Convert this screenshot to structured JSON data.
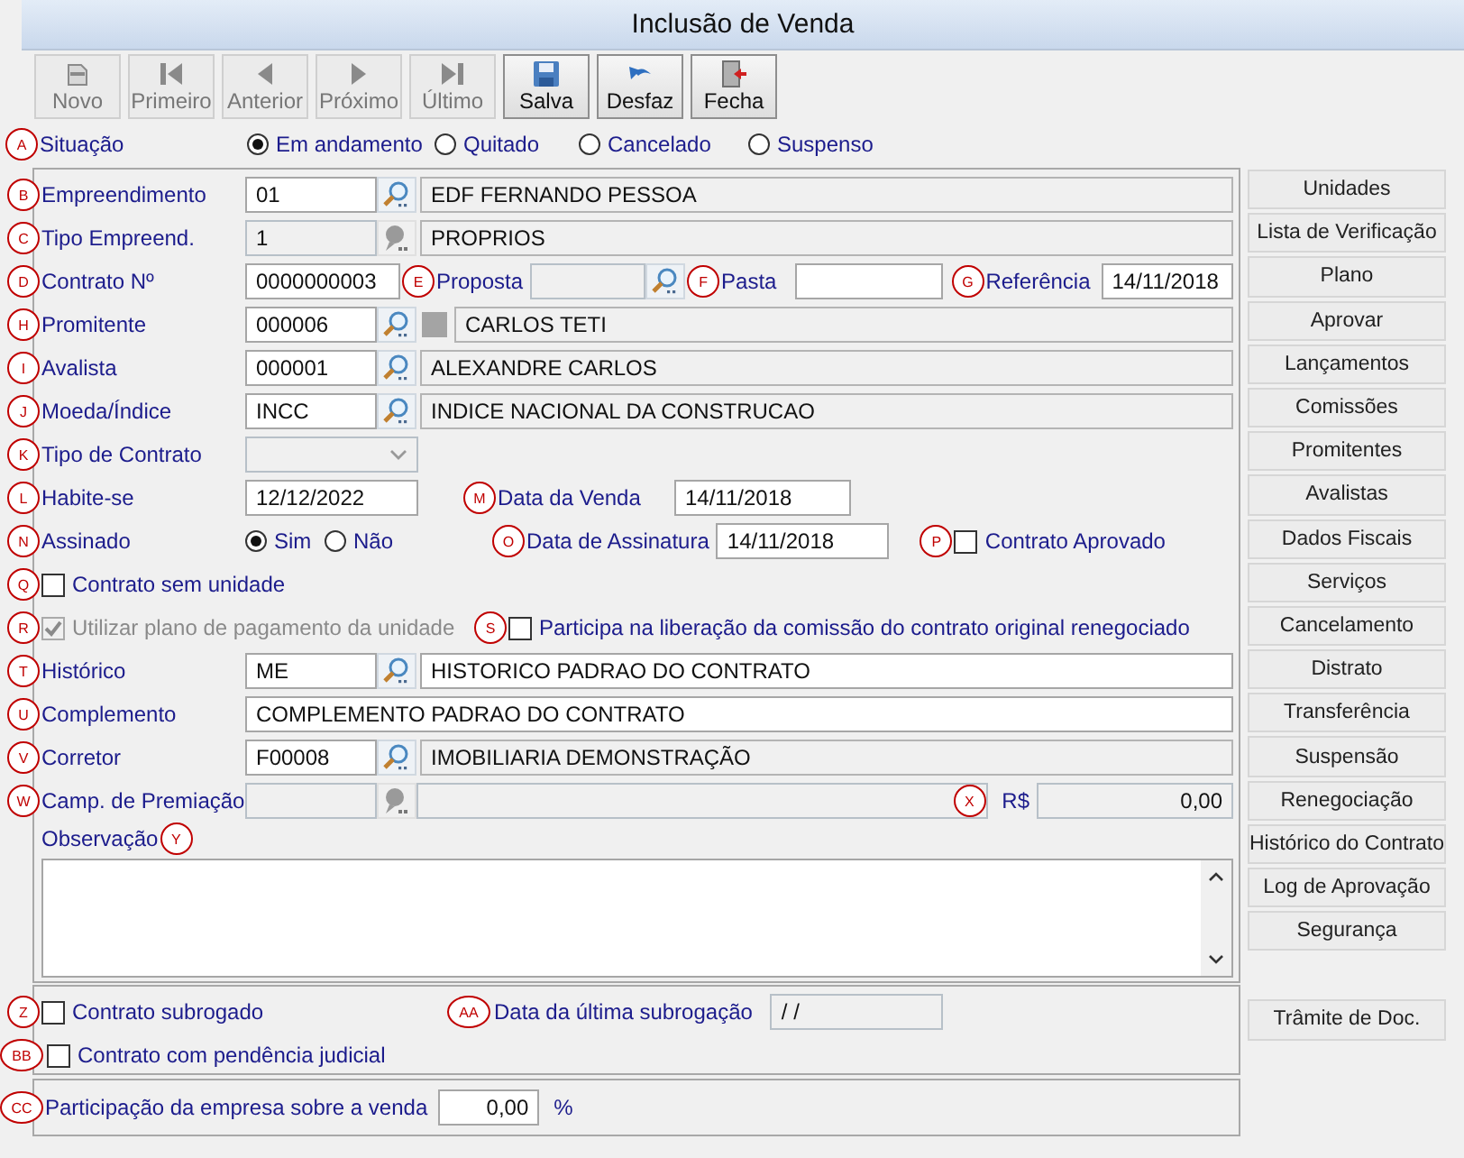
{
  "window": {
    "title": "Inclusão de Venda"
  },
  "toolbar": [
    {
      "kind": "new",
      "label": "Novo",
      "disabled": true
    },
    {
      "kind": "first",
      "label": "Primeiro",
      "disabled": true
    },
    {
      "kind": "prev",
      "label": "Anterior",
      "disabled": true
    },
    {
      "kind": "next",
      "label": "Próximo",
      "disabled": true
    },
    {
      "kind": "last",
      "label": "Último",
      "disabled": true
    },
    {
      "kind": "save",
      "label": "Salva",
      "disabled": false
    },
    {
      "kind": "undo",
      "label": "Desfaz",
      "disabled": false
    },
    {
      "kind": "close",
      "label": "Fecha",
      "disabled": false
    }
  ],
  "situacao": {
    "marker": "A",
    "label": "Situação",
    "options": [
      {
        "label": "Em andamento",
        "selected": true
      },
      {
        "label": "Quitado",
        "selected": false
      },
      {
        "label": "Cancelado",
        "selected": false
      },
      {
        "label": "Suspenso",
        "selected": false
      }
    ]
  },
  "empreendimento": {
    "marker": "B",
    "label": "Empreendimento",
    "code": "01",
    "description": "EDF FERNANDO PESSOA",
    "disabled": false,
    "description_editable": false,
    "swatch": false
  },
  "tipo_empreend": {
    "marker": "C",
    "label": "Tipo Empreend.",
    "code": "1",
    "description": "PROPRIOS",
    "disabled": true,
    "description_editable": false,
    "swatch": false
  },
  "contrato": {
    "marker": "D",
    "label": "Contrato Nº",
    "value": "0000000003"
  },
  "proposta": {
    "marker": "E",
    "label": "Proposta",
    "disabled": true
  },
  "pasta": {
    "marker": "F",
    "label": "Pasta"
  },
  "referencia": {
    "marker": "G",
    "label": "Referência",
    "value": "14/11/2018"
  },
  "promitente": {
    "marker": "H",
    "label": "Promitente",
    "code": "000006",
    "description": "CARLOS TETI",
    "disabled": false,
    "description_editable": false,
    "swatch": true
  },
  "avalista": {
    "marker": "I",
    "label": "Avalista",
    "code": "000001",
    "description": "ALEXANDRE CARLOS",
    "disabled": false,
    "description_editable": false,
    "swatch": false
  },
  "moeda": {
    "marker": "J",
    "label": "Moeda/Índice",
    "code": "INCC",
    "description": "INDICE NACIONAL DA CONSTRUCAO",
    "disabled": false,
    "description_editable": false,
    "swatch": false
  },
  "tipo_contrato": {
    "marker": "K",
    "label": "Tipo de Contrato",
    "disabled": true
  },
  "habite_se": {
    "marker": "L",
    "label": "Habite-se",
    "value": "12/12/2022"
  },
  "data_venda": {
    "marker": "M",
    "label": "Data da Venda",
    "value": "14/11/2018"
  },
  "assinado": {
    "marker": "N",
    "label": "Assinado",
    "options": [
      {
        "label": "Sim",
        "selected": true
      },
      {
        "label": "Não",
        "selected": false
      }
    ]
  },
  "data_assinatura": {
    "marker": "O",
    "label": "Data de Assinatura",
    "value": "14/11/2018"
  },
  "contrato_aprovado": {
    "marker": "P",
    "label": "Contrato Aprovado",
    "checked": false
  },
  "contrato_sem_unidade": {
    "marker": "Q",
    "label": "Contrato sem unidade",
    "checked": false
  },
  "utilizar_plano": {
    "marker": "R",
    "label": "Utilizar plano de pagamento da unidade",
    "checked": true,
    "disabled": true
  },
  "participa_liberacao": {
    "marker": "S",
    "label": "Participa na liberação da comissão do contrato original renegociado",
    "checked": false
  },
  "historico": {
    "marker": "T",
    "label": "Histórico",
    "code": "ME",
    "description": "HISTORICO PADRAO DO CONTRATO",
    "disabled": false,
    "description_editable": true,
    "swatch": false
  },
  "complemento": {
    "marker": "U",
    "label": "Complemento",
    "value": "COMPLEMENTO PADRAO DO CONTRATO"
  },
  "corretor": {
    "marker": "V",
    "label": "Corretor",
    "code": "F00008",
    "description": "IMOBILIARIA DEMONSTRAÇÃO",
    "disabled": false,
    "description_editable": false,
    "swatch": false
  },
  "camp_premiacao": {
    "marker": "W",
    "label": "Camp. de Premiação",
    "disabled": true
  },
  "valor": {
    "marker": "X",
    "label": "R$",
    "value": "0,00",
    "disabled": true
  },
  "observacao": {
    "marker": "Y",
    "label": "Observação"
  },
  "contrato_subrogado": {
    "marker": "Z",
    "label": "Contrato subrogado",
    "checked": false
  },
  "data_subrogacao": {
    "marker": "AA",
    "label": "Data da última subrogação",
    "value": "/ /",
    "disabled": true
  },
  "pendencia_judicial": {
    "marker": "BB",
    "label": "Contrato com pendência judicial",
    "checked": false
  },
  "participacao": {
    "marker": "CC",
    "label": "Participação da empresa sobre a venda",
    "value": "0,00",
    "unit": "%"
  },
  "side_buttons": [
    {
      "label": "Unidades"
    },
    {
      "label": "Lista de Verificação"
    },
    {
      "label": "Plano"
    },
    {
      "label": "Aprovar"
    },
    {
      "label": "Lançamentos"
    },
    {
      "label": "Comissões"
    },
    {
      "label": "Promitentes"
    },
    {
      "label": "Avalistas"
    },
    {
      "label": "Dados Fiscais"
    },
    {
      "label": "Serviços"
    },
    {
      "label": "Cancelamento"
    },
    {
      "label": "Distrato"
    },
    {
      "label": "Transferência"
    },
    {
      "label": "Suspensão"
    },
    {
      "label": "Renegociação"
    },
    {
      "label": "Histórico do Contrato"
    },
    {
      "label": "Log de Aprovação"
    },
    {
      "label": "Segurança"
    }
  ],
  "side_button_bottom": {
    "label": "Trâmite de Doc."
  }
}
